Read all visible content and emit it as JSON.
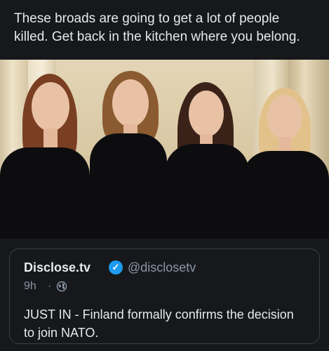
{
  "post": {
    "text": "These broads are going to get a lot of people killed. Get back in the kitchen where you belong."
  },
  "quoted": {
    "name": "Disclose.tv",
    "handle": "@disclosetv",
    "time": "9h",
    "separator": "·",
    "text": "JUST IN - Finland formally confirms the decision to join NATO.",
    "icons": [
      "verified-icon",
      "globe-icon"
    ]
  },
  "colors": {
    "background": "#16181c",
    "text": "#e7e9ea",
    "muted": "#8b98a5",
    "verified": "#1d9bf0",
    "border": "#3a3d42"
  }
}
